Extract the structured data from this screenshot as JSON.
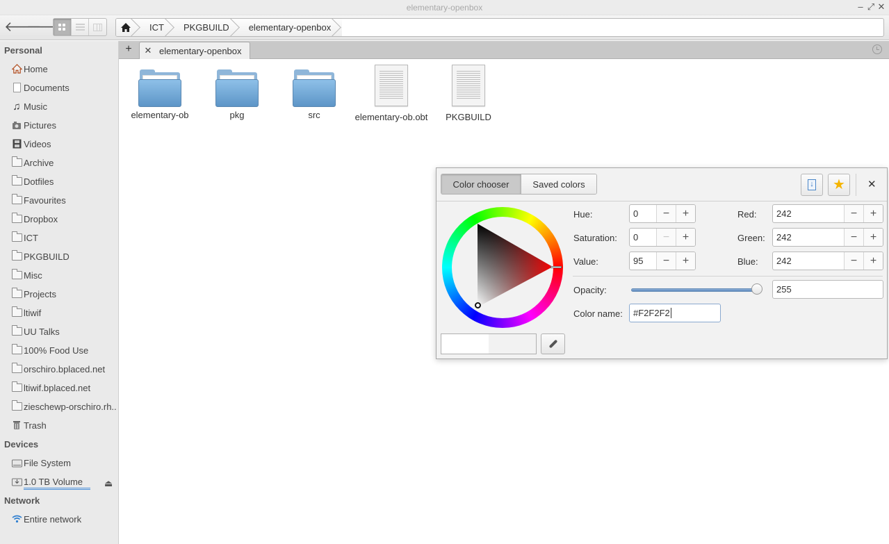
{
  "window": {
    "title": "elementary-openbox"
  },
  "toolbar": {
    "breadcrumbs": [
      "ICT",
      "PKGBUILD",
      "elementary-openbox"
    ]
  },
  "sidebar": {
    "sections": {
      "personal": "Personal",
      "devices": "Devices",
      "network": "Network"
    },
    "personal_items": [
      {
        "label": "Home",
        "icon": "home-icon"
      },
      {
        "label": "Documents",
        "icon": "document-icon"
      },
      {
        "label": "Music",
        "icon": "music-icon"
      },
      {
        "label": "Pictures",
        "icon": "pictures-icon"
      },
      {
        "label": "Videos",
        "icon": "videos-icon"
      },
      {
        "label": "Archive",
        "icon": "folder-icon"
      },
      {
        "label": "Dotfiles",
        "icon": "folder-icon"
      },
      {
        "label": "Favourites",
        "icon": "folder-icon"
      },
      {
        "label": "Dropbox",
        "icon": "folder-icon"
      },
      {
        "label": "ICT",
        "icon": "folder-icon"
      },
      {
        "label": "PKGBUILD",
        "icon": "folder-icon"
      },
      {
        "label": "Misc",
        "icon": "folder-icon"
      },
      {
        "label": "Projects",
        "icon": "folder-icon"
      },
      {
        "label": "ltiwif",
        "icon": "folder-icon"
      },
      {
        "label": "UU Talks",
        "icon": "folder-icon"
      },
      {
        "label": "100% Food Use",
        "icon": "folder-icon"
      },
      {
        "label": "orschiro.bplaced.net",
        "icon": "folder-icon"
      },
      {
        "label": "ltiwif.bplaced.net",
        "icon": "folder-icon"
      },
      {
        "label": "zieschewp-orschiro.rh...",
        "icon": "folder-icon"
      },
      {
        "label": "Trash",
        "icon": "trash-icon"
      }
    ],
    "device_items": [
      {
        "label": "File System",
        "icon": "drive-icon"
      },
      {
        "label": "1.0 TB Volume",
        "icon": "usb-drive-icon"
      }
    ],
    "network_items": [
      {
        "label": "Entire network",
        "icon": "wifi-icon"
      }
    ]
  },
  "tabs": [
    {
      "label": "elementary-openbox"
    }
  ],
  "files": [
    {
      "name": "elementary-ob",
      "type": "folder"
    },
    {
      "name": "pkg",
      "type": "folder"
    },
    {
      "name": "src",
      "type": "folder"
    },
    {
      "name": "elementary-ob.obt",
      "type": "text"
    },
    {
      "name": "PKGBUILD",
      "type": "text"
    }
  ],
  "color_dialog": {
    "tabs": {
      "chooser": "Color chooser",
      "saved": "Saved colors"
    },
    "hue_label": "Hue:",
    "hue": "0",
    "saturation_label": "Saturation:",
    "saturation": "0",
    "value_label": "Value:",
    "value": "95",
    "red_label": "Red:",
    "red": "242",
    "green_label": "Green:",
    "green": "242",
    "blue_label": "Blue:",
    "blue": "242",
    "opacity_label": "Opacity:",
    "opacity": "255",
    "opacity_fraction": 1.0,
    "color_name_label": "Color name:",
    "color_name": "#F2F2F2",
    "current_color": "#F2F2F2"
  },
  "colors": {
    "accent": "#4a90d9",
    "folder": "#6fa3d3"
  }
}
